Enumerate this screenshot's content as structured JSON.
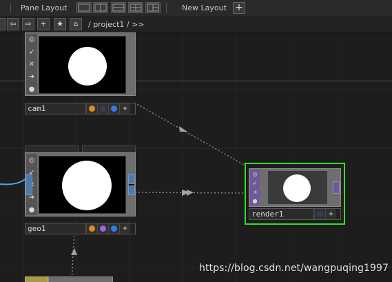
{
  "toolbar": {
    "pane_layout_label": "Pane Layout",
    "new_layout_label": "New Layout",
    "add_symbol": "+"
  },
  "nav": {
    "path": "/ project1 / >>",
    "back_icon": "⇦",
    "forward_icon": "⇨",
    "add_icon": "+",
    "star_icon": "★",
    "home_icon": "⌂"
  },
  "nodes": [
    {
      "name": "cam1",
      "type": "camera-comp",
      "flags": [
        "#e08a1e",
        "#3c3c4a",
        "#2f7fe6"
      ]
    },
    {
      "name": "geo1",
      "type": "geometry-comp",
      "flags": [
        "#e08a1e",
        "#9a66e0",
        "#2f7fe6"
      ]
    },
    {
      "name": "render1",
      "type": "render-top",
      "selected": true,
      "flags": [
        "#2e3f5e"
      ]
    }
  ],
  "colors": {
    "selection": "#33e02a",
    "top_family": "#6e5a9a",
    "comp_connector": "#4d7aa8",
    "wire": "#7f8a96"
  },
  "watermark": "https://blog.csdn.net/wangpuqing1997"
}
